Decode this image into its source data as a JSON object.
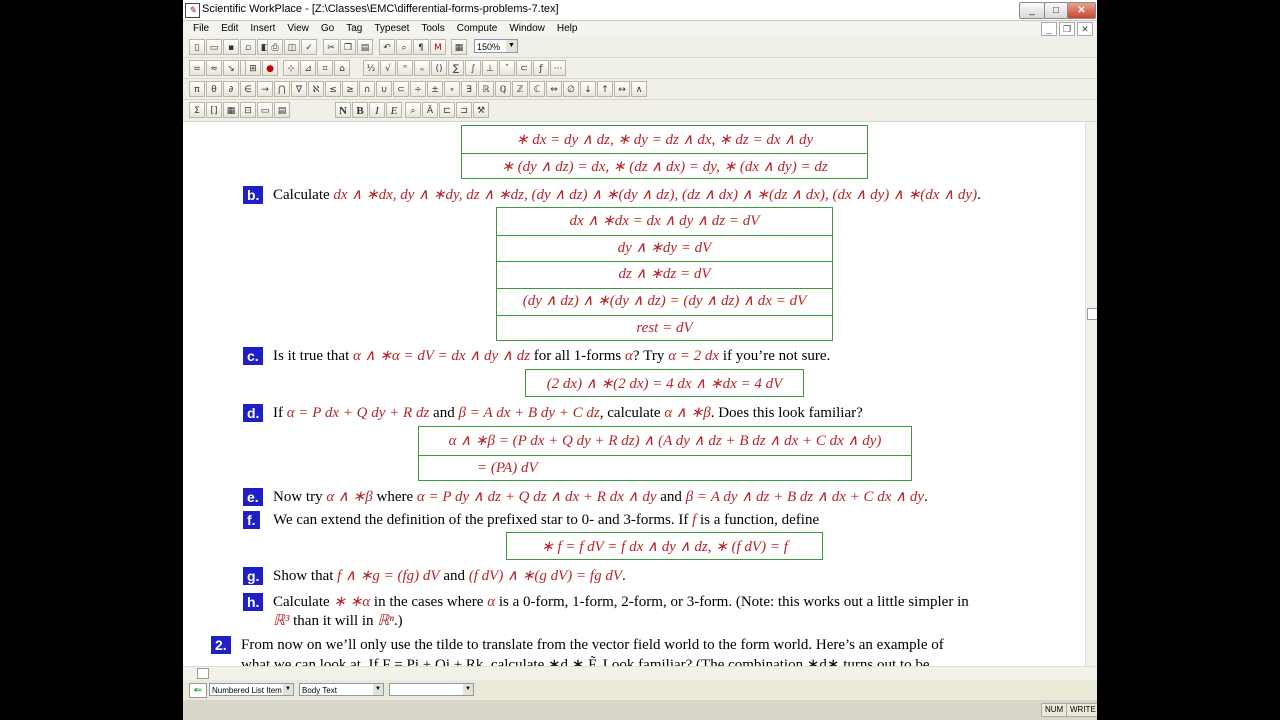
{
  "window": {
    "title": "Scientific WorkPlace - [Z:\\Classes\\EMC\\differential-forms-problems-7.tex]",
    "btn_min": "_",
    "btn_max": "□",
    "btn_close": "✕"
  },
  "menu": {
    "items": [
      "File",
      "Edit",
      "Insert",
      "View",
      "Go",
      "Tag",
      "Typeset",
      "Tools",
      "Compute",
      "Window",
      "Help"
    ],
    "mdi_min": "_",
    "mdi_restore": "❐",
    "mdi_close": "✕"
  },
  "toolbar": {
    "zoom": "150%"
  },
  "doc": {
    "row_a1": "∗ dx = dy ∧ dz,  ∗ dy = dz ∧ dx,  ∗ dz = dx ∧ dy",
    "row_a2": "∗ (dy ∧ dz) = dx,  ∗ (dz ∧ dx) = dy,  ∗ (dx ∧ dy) = dz",
    "b_label": "b.",
    "b_text": "Calculate ",
    "b_math": "dx ∧ ∗dx, dy ∧ ∗dy, dz ∧ ∗dz, (dy ∧ dz) ∧ ∗(dy ∧ dz), (dz ∧ dx) ∧ ∗(dz ∧ dx), (dx ∧ dy) ∧ ∗(dx ∧ dy)",
    "b_end": ".",
    "b_rows": [
      "dx ∧ ∗dx = dx ∧ dy ∧ dz = dV",
      "dy ∧ ∗dy = dV",
      "dz ∧ ∗dz = dV",
      "(dy ∧ dz) ∧ ∗(dy ∧ dz) = (dy ∧ dz) ∧ dx = dV",
      "rest = dV"
    ],
    "c_label": "c.",
    "c_t1": "Is it true that ",
    "c_m1": "α ∧ ∗α = dV = dx ∧ dy ∧ dz",
    "c_t2": " for all 1-forms ",
    "c_m2": "α",
    "c_t3": "? Try ",
    "c_m3": "α = 2 dx",
    "c_t4": " if you’re not sure.",
    "c_box": "(2 dx) ∧ ∗(2 dx) = 4 dx ∧ ∗dx = 4 dV",
    "d_label": "d.",
    "d_t1": "If ",
    "d_m1": "α = P dx + Q dy + R dz",
    "d_t2": " and ",
    "d_m2": "β = A dx + B dy + C dz",
    "d_t3": ", calculate ",
    "d_m3": "α ∧ ∗β",
    "d_t4": ". Does this look familiar?",
    "d_row1": "α ∧ ∗β = (P dx + Q dy + R dz) ∧ (A dy ∧ dz + B dz ∧ dx + C dx ∧ dy)",
    "d_row2": "= (PA) dV",
    "e_label": "e.",
    "e_t1": "Now try ",
    "e_m1": "α ∧ ∗β",
    "e_t2": " where ",
    "e_m2": "α = P dy ∧ dz + Q dz ∧ dx + R dx ∧ dy",
    "e_t3": " and ",
    "e_m3": "β = A dy ∧ dz + B dz ∧ dx + C dx ∧ dy",
    "e_t4": ".",
    "f_label": "f.",
    "f_t1": "We can extend the definition of the prefixed star to 0- and 3-forms. If ",
    "f_m1": "f",
    "f_t2": " is a function, define",
    "f_box": "∗ f = f dV = f dx ∧ dy ∧ dz,    ∗ (f dV) = f",
    "g_label": "g.",
    "g_t1": "Show that ",
    "g_m1": "f ∧ ∗g = (fg) dV",
    "g_t2": " and ",
    "g_m2": "(f dV) ∧ ∗(g dV) = fg dV",
    "g_t3": ".",
    "h_label": "h.",
    "h_t1": "Calculate ",
    "h_m1": "∗ ∗α",
    "h_t2": " in the cases where ",
    "h_m2": "α",
    "h_t3": " is a 0-form, 1-form, 2-form, or 3-form. (Note: this works out a little simpler in",
    "h_l2a": "ℝ³",
    "h_l2b": " than it will in ",
    "h_l2c": "ℝⁿ",
    "h_l2d": ".)",
    "p2_label": "2.",
    "p2_t1": "From now on we’ll only use the tilde to translate from the vector field world to the form world. Here’s an example of",
    "p2_t2": "what we can look at. If F = Pi + Qj + Rk, calculate ∗d ∗ F̃. Look familiar? (The combination ∗d∗ turns out to be"
  },
  "status": {
    "tag1": "Numbered List Item",
    "tag2": "Body Text",
    "tag3": "",
    "num": "NUM",
    "write": "WRITE"
  }
}
